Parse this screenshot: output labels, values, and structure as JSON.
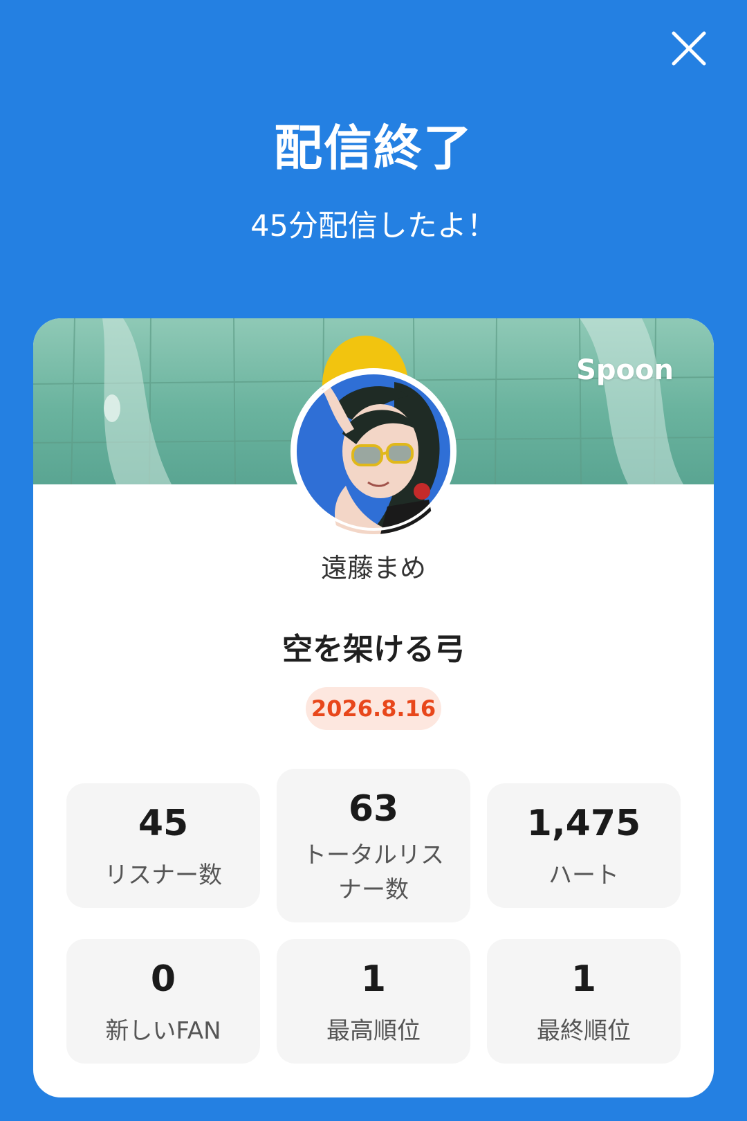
{
  "header": {
    "title": "配信終了",
    "subtitle": "45分配信したよ！"
  },
  "card": {
    "brand": "Spoon",
    "streamer_name": "遠藤まめ",
    "stream_title": "空を架ける弓",
    "date": "2026.8.16"
  },
  "stats": [
    {
      "value": "45",
      "label": "リスナー数"
    },
    {
      "value": "63",
      "label": "トータルリスナー数"
    },
    {
      "value": "1,475",
      "label": "ハート"
    },
    {
      "value": "0",
      "label": "新しいFAN"
    },
    {
      "value": "1",
      "label": "最高順位"
    },
    {
      "value": "1",
      "label": "最終順位"
    }
  ],
  "icons": {
    "close": "close-icon"
  },
  "colors": {
    "background": "#2480e2",
    "badge_bg": "#fde7df",
    "badge_text": "#e8471b"
  }
}
